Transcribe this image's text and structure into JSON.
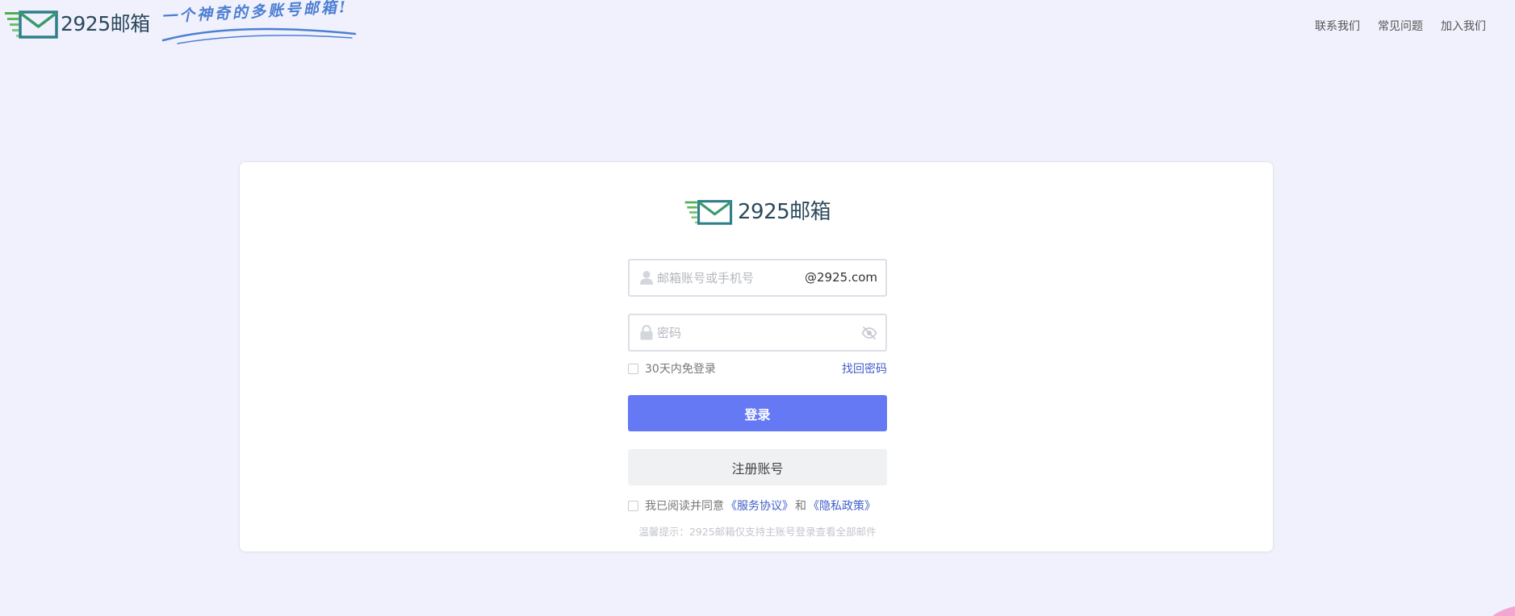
{
  "header": {
    "brand_name": "2925邮箱",
    "slogan": "一个神奇的多账号邮箱!",
    "nav": [
      {
        "label": "联系我们"
      },
      {
        "label": "常见问题"
      },
      {
        "label": "加入我们"
      }
    ]
  },
  "card": {
    "brand_name": "2925邮箱",
    "account": {
      "placeholder": "邮箱账号或手机号",
      "value": "",
      "suffix": "@2925.com"
    },
    "password": {
      "placeholder": "密码",
      "value": ""
    },
    "remember_label": "30天内免登录",
    "remember_checked": false,
    "forgot_label": "找回密码",
    "login_label": "登录",
    "register_label": "注册账号",
    "agree": {
      "checked": false,
      "prefix": "我已阅读并同意",
      "service_link": "《服务协议》",
      "and": "和",
      "privacy_link": "《隐私政策》"
    },
    "tip": "温馨提示：2925邮箱仅支持主账号登录查看全部邮件"
  },
  "icons": {
    "logo": "envelope-logo-icon",
    "user": "user-icon",
    "lock": "lock-icon",
    "eye": "eye-off-icon"
  },
  "colors": {
    "page_background": "#f0f1fc",
    "primary_button": "#6579f5",
    "link": "#3f5ec9",
    "brand_text": "#2b4a5c",
    "slogan": "#4d7fd2",
    "logo_green": "#4caf50",
    "logo_teal": "#2f7f8a"
  }
}
